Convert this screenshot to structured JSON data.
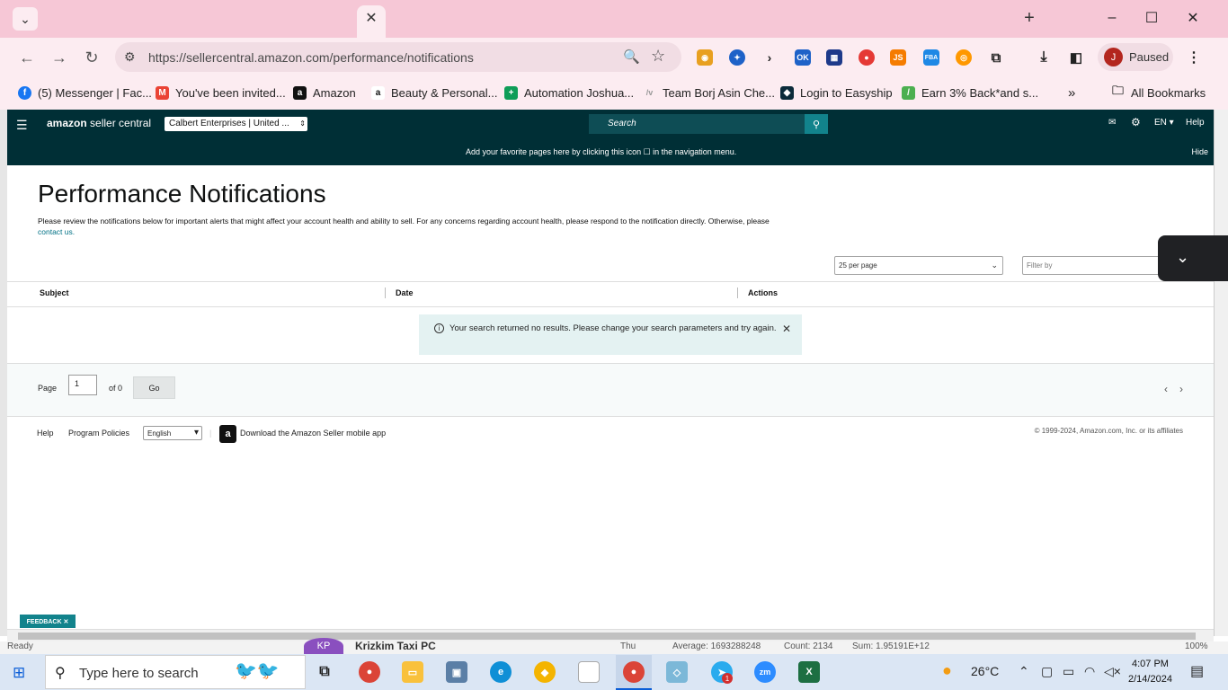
{
  "browser": {
    "active_tab_close": "✕",
    "new_tab": "+",
    "window_controls": {
      "minimize": "–",
      "maximize": "☐",
      "close": "✕"
    },
    "url": "https://sellercentral.amazon.com/performance/notifications",
    "profile_initial": "J",
    "profile_status": "Paused",
    "bookmarks": [
      {
        "label": "(5) Messenger | Fac...",
        "icon": "facebook-icon",
        "color": "#1877f2"
      },
      {
        "label": "You've been invited...",
        "icon": "gmail-icon",
        "color": "#ea4335"
      },
      {
        "label": "Amazon",
        "icon": "amazon-icon",
        "color": "#111111"
      },
      {
        "label": "Beauty & Personal...",
        "icon": "amazon-a-icon",
        "color": "#ff9900"
      },
      {
        "label": "Automation Joshua...",
        "icon": "sheets-icon",
        "color": "#0f9d58"
      },
      {
        "label": "Team Borj Asin Che...",
        "icon": "team-icon",
        "color": "#888888"
      },
      {
        "label": "Login to Easyship",
        "icon": "easyship-icon",
        "color": "#0b2b3a"
      },
      {
        "label": "Earn 3% Back*and s...",
        "icon": "cashback-icon",
        "color": "#4caf50"
      }
    ],
    "all_bookmarks": "All Bookmarks"
  },
  "seller_central": {
    "logo_bold": "amazon",
    "logo_rest": " seller central",
    "account": "Calbert Enterprises | United ...",
    "search_placeholder": "Search",
    "language": "EN ▾",
    "help": "Help",
    "favorites_message": "Add your favorite pages here by clicking this icon ☐ in the navigation menu.",
    "hide": "Hide"
  },
  "page": {
    "title": "Performance Notifications",
    "intro": "Please review the notifications below for important alerts that might affect your account health and ability to sell. For any concerns regarding account health, please respond to the notification directly. Otherwise, please",
    "intro_link": "contact us.",
    "per_page": "25 per page",
    "filter_placeholder": "Filter by",
    "columns": [
      "Subject",
      "Date",
      "Actions"
    ],
    "alert_text": "Your search returned no results. Please change your search parameters and try again.",
    "page_label": "Page",
    "page_value": "1",
    "of_label": "of 0",
    "go": "Go"
  },
  "footer": {
    "help": "Help",
    "program_policies": "Program Policies",
    "language": "English",
    "app_link": "Download the Amazon Seller mobile app",
    "copyright": "© 1999-2024, Amazon.com, Inc. or its affiliates",
    "feedback": "FEEDBACK ✕"
  },
  "excel_underlay": {
    "status": "Ready",
    "avatar": "KP",
    "name": "Krizkim Taxi PC",
    "day": "Thu",
    "average": "Average: 1693288248",
    "count": "Count: 2134",
    "sum": "Sum: 1.95191E+12",
    "zoom": "100%"
  },
  "taskbar": {
    "search_placeholder": "Type here to search",
    "weather": "26°C",
    "time": "4:07 PM",
    "date": "2/14/2024",
    "telegram_badge": "1"
  }
}
